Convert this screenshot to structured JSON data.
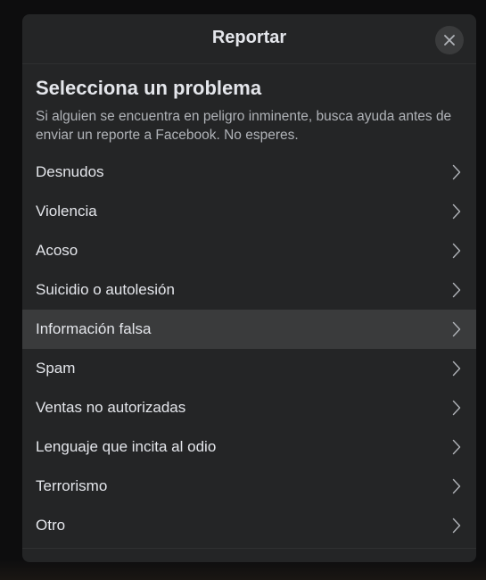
{
  "dialog": {
    "title": "Reportar",
    "close_icon": "close-icon"
  },
  "section": {
    "title": "Selecciona un problema",
    "description": "Si alguien se encuentra en peligro inminente, busca ayuda antes de enviar un reporte a Facebook. No esperes."
  },
  "items": [
    {
      "label": "Desnudos",
      "icon": "chevron-right-icon"
    },
    {
      "label": "Violencia",
      "icon": "chevron-right-icon"
    },
    {
      "label": "Acoso",
      "icon": "chevron-right-icon"
    },
    {
      "label": "Suicidio o autolesión",
      "icon": "chevron-right-icon"
    },
    {
      "label": "Información falsa",
      "icon": "chevron-right-icon",
      "highlighted": true
    },
    {
      "label": "Spam",
      "icon": "chevron-right-icon"
    },
    {
      "label": "Ventas no autorizadas",
      "icon": "chevron-right-icon"
    },
    {
      "label": "Lenguaje que incita al odio",
      "icon": "chevron-right-icon"
    },
    {
      "label": "Terrorismo",
      "icon": "chevron-right-icon"
    },
    {
      "label": "Otro",
      "icon": "chevron-right-icon"
    }
  ],
  "colors": {
    "dialog_bg": "#242526",
    "highlight_bg": "#3a3b3c",
    "primary_text": "#e4e6eb",
    "secondary_text": "#b0b3b8"
  }
}
